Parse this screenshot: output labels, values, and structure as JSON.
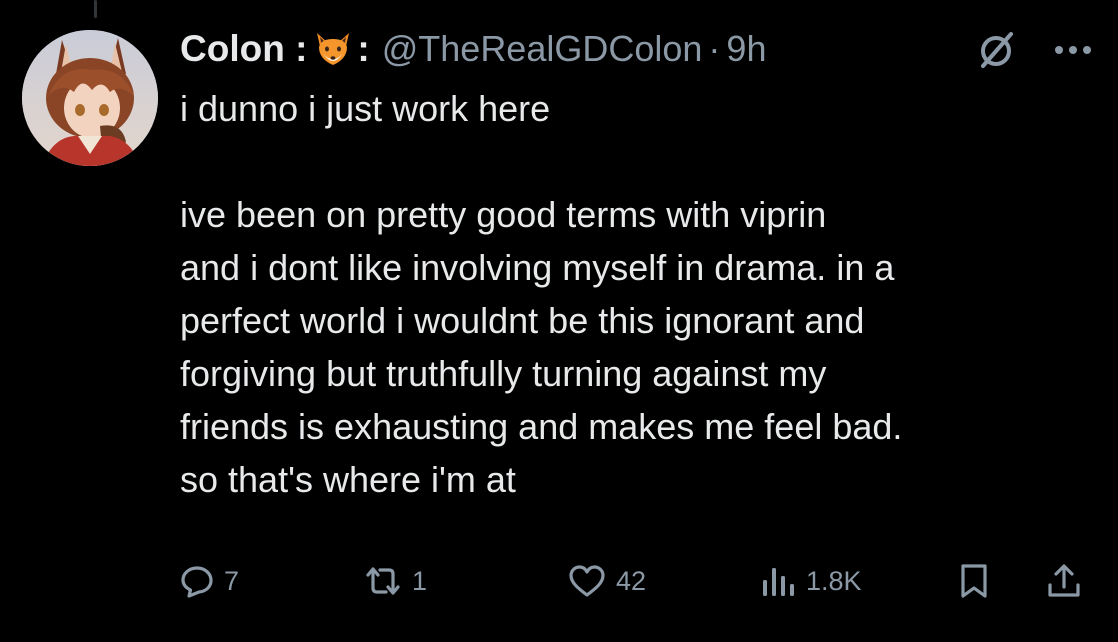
{
  "author": {
    "display_name": "Colon :",
    "name_emoji": "fox-face-icon",
    "name_suffix": ":",
    "handle": "@TheRealGDColon",
    "separator": "·",
    "time": "9h"
  },
  "tweet": {
    "text": "i dunno i just work here\n\nive been on pretty good terms with viprin\nand i dont like involving myself in drama. in a\nperfect world i wouldnt be this ignorant and\nforgiving but truthfully turning against my\nfriends is exhausting and makes me feel bad.\nso that's where i'm at"
  },
  "actions": {
    "replies": "7",
    "reposts": "1",
    "likes": "42",
    "views": "1.8K",
    "reply_icon": "reply-icon",
    "repost_icon": "repost-icon",
    "like_icon": "heart-icon",
    "views_icon": "views-icon",
    "bookmark_icon": "bookmark-icon",
    "share_icon": "share-icon"
  },
  "header_icons": {
    "grok": "grok-icon",
    "more": "more-icon"
  },
  "colors": {
    "background": "#000000",
    "text_primary": "#e7e9ea",
    "text_secondary": "#8b98a5"
  }
}
